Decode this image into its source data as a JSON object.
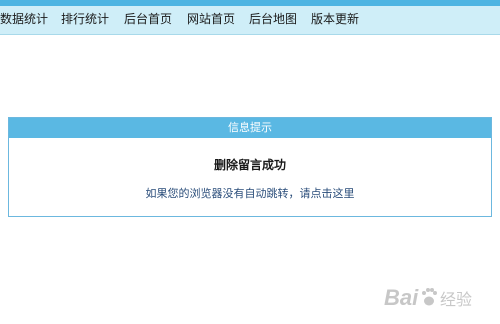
{
  "nav": {
    "items": [
      "数据统计",
      "排行统计",
      "后台首页",
      "网站首页",
      "后台地图",
      "版本更新"
    ]
  },
  "dialog": {
    "title": "信息提示",
    "message": "删除留言成功",
    "redirect_text": "如果您的浏览器没有自动跳转，请点击这里"
  },
  "watermark": {
    "text": "Bai 经验"
  },
  "colors": {
    "accent": "#4db4e2",
    "nav_bg": "#cfeef8",
    "dialog_header": "#5ab8e3",
    "link": "#2a4d7a"
  }
}
